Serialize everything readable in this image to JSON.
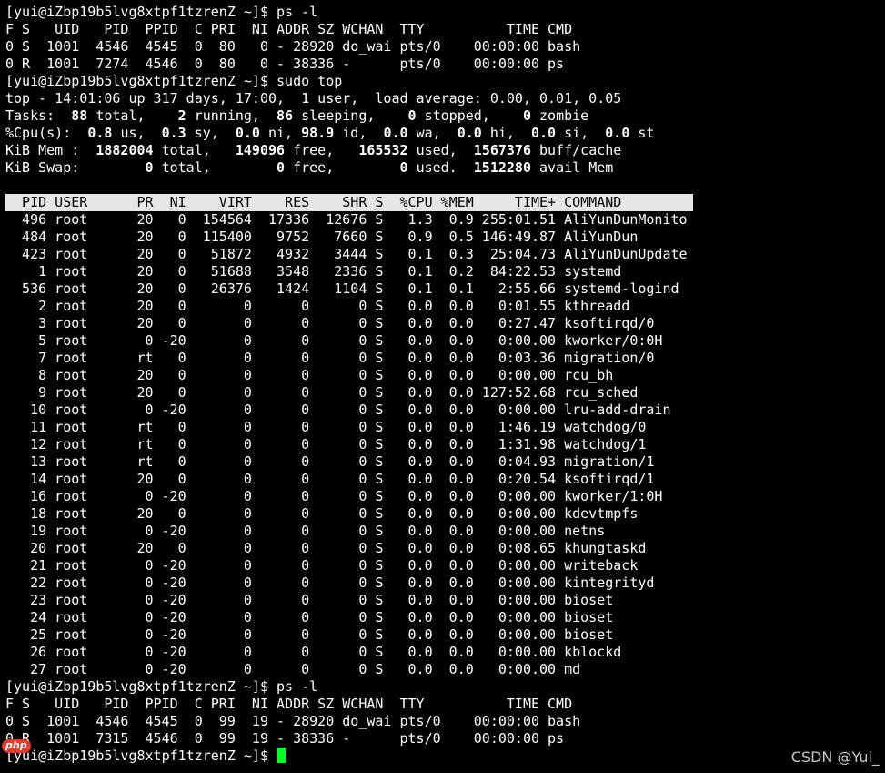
{
  "colors": {
    "background": "#000000",
    "foreground": "#ffffff",
    "header_bar": "#e6e6e6",
    "cursor": "#00ff2a",
    "watermark": "#c8c8c8",
    "logo_bg": "#e23c2c"
  },
  "ps1": {
    "prompt": "[yui@iZbp19b5lvg8xtpf1tzrenZ ~]$ ps -l",
    "header": "F S   UID   PID  PPID  C PRI  NI ADDR SZ WCHAN  TTY          TIME CMD",
    "rows": [
      "0 S  1001  4546  4545  0  80   0 - 28920 do_wai pts/0    00:00:00 bash",
      "0 R  1001  7274  4546  0  80   0 - 38336 -      pts/0    00:00:00 ps"
    ]
  },
  "top_prompt": "[yui@iZbp19b5lvg8xtpf1tzrenZ ~]$ sudo top",
  "top_summary": {
    "line1": "top - 14:01:06 up 317 days, 17:00,  1 user,  load average: 0.00, 0.01, 0.05",
    "tasks": {
      "label": "Tasks:",
      "total": "88",
      "total_label": "total,",
      "running": "2",
      "running_label": "running,",
      "sleeping": "86",
      "sleeping_label": "sleeping,",
      "stopped": "0",
      "stopped_label": "stopped,",
      "zombie": "0",
      "zombie_label": "zombie"
    },
    "cpu": {
      "label": "%Cpu(s):",
      "us": "0.8",
      "us_label": "us,",
      "sy": "0.3",
      "sy_label": "sy,",
      "ni": "0.0",
      "ni_label": "ni,",
      "id": "98.9",
      "id_label": "id,",
      "wa": "0.0",
      "wa_label": "wa,",
      "hi": "0.0",
      "hi_label": "hi,",
      "si": "0.0",
      "si_label": "si,",
      "st": "0.0",
      "st_label": "st"
    },
    "mem": {
      "label": "KiB Mem :",
      "total": "1882004",
      "total_label": "total,",
      "free": "149096",
      "free_label": "free,",
      "used": "165532",
      "used_label": "used,",
      "cache": "1567376",
      "cache_label": "buff/cache"
    },
    "swap": {
      "label": "KiB Swap:",
      "total": "0",
      "total_label": "total,",
      "free": "0",
      "free_label": "free,",
      "used": "0",
      "used_label": "used.",
      "avail": "1512280",
      "avail_label": "avail Mem"
    }
  },
  "process_table": {
    "header": "  PID USER      PR  NI    VIRT    RES    SHR S  %CPU %MEM     TIME+ COMMAND",
    "rows": [
      "  496 root      20   0  154564  17336  12676 S   1.3  0.9 255:01.51 AliYunDunMonito",
      "  484 root      20   0  115400   9752   7660 S   0.9  0.5 146:49.87 AliYunDun",
      "  423 root      20   0   51872   4932   3444 S   0.1  0.3  25:04.73 AliYunDunUpdate",
      "    1 root      20   0   51688   3548   2336 S   0.1  0.2  84:22.53 systemd",
      "  536 root      20   0   26376   1424   1104 S   0.1  0.1   2:55.66 systemd-logind",
      "    2 root      20   0       0      0      0 S   0.0  0.0   0:01.55 kthreadd",
      "    3 root      20   0       0      0      0 S   0.0  0.0   0:27.47 ksoftirqd/0",
      "    5 root       0 -20       0      0      0 S   0.0  0.0   0:00.00 kworker/0:0H",
      "    7 root      rt   0       0      0      0 S   0.0  0.0   0:03.36 migration/0",
      "    8 root      20   0       0      0      0 S   0.0  0.0   0:00.00 rcu_bh",
      "    9 root      20   0       0      0      0 S   0.0  0.0 127:52.68 rcu_sched",
      "   10 root       0 -20       0      0      0 S   0.0  0.0   0:00.00 lru-add-drain",
      "   11 root      rt   0       0      0      0 S   0.0  0.0   1:46.19 watchdog/0",
      "   12 root      rt   0       0      0      0 S   0.0  0.0   1:31.98 watchdog/1",
      "   13 root      rt   0       0      0      0 S   0.0  0.0   0:04.93 migration/1",
      "   14 root      20   0       0      0      0 S   0.0  0.0   0:20.54 ksoftirqd/1",
      "   16 root       0 -20       0      0      0 S   0.0  0.0   0:00.00 kworker/1:0H",
      "   18 root      20   0       0      0      0 S   0.0  0.0   0:00.00 kdevtmpfs",
      "   19 root       0 -20       0      0      0 S   0.0  0.0   0:00.00 netns",
      "   20 root      20   0       0      0      0 S   0.0  0.0   0:08.65 khungtaskd",
      "   21 root       0 -20       0      0      0 S   0.0  0.0   0:00.00 writeback",
      "   22 root       0 -20       0      0      0 S   0.0  0.0   0:00.00 kintegrityd",
      "   23 root       0 -20       0      0      0 S   0.0  0.0   0:00.00 bioset",
      "   24 root       0 -20       0      0      0 S   0.0  0.0   0:00.00 bioset",
      "   25 root       0 -20       0      0      0 S   0.0  0.0   0:00.00 bioset",
      "   26 root       0 -20       0      0      0 S   0.0  0.0   0:00.00 kblockd",
      "   27 root       0 -20       0      0      0 S   0.0  0.0   0:00.00 md"
    ]
  },
  "ps2": {
    "prompt": "[yui@iZbp19b5lvg8xtpf1tzrenZ ~]$ ps -l",
    "header": "F S   UID   PID  PPID  C PRI  NI ADDR SZ WCHAN  TTY          TIME CMD",
    "rows": [
      "0 S  1001  4546  4545  0  99  19 - 28920 do_wai pts/0    00:00:00 bash",
      "0 R  1001  7315  4546  0  99  19 - 38336 -      pts/0    00:00:00 ps"
    ]
  },
  "final_prompt": "[yui@iZbp19b5lvg8xtpf1tzrenZ ~]$ ",
  "watermark": "CSDN @Yui_",
  "logo_text": "php"
}
